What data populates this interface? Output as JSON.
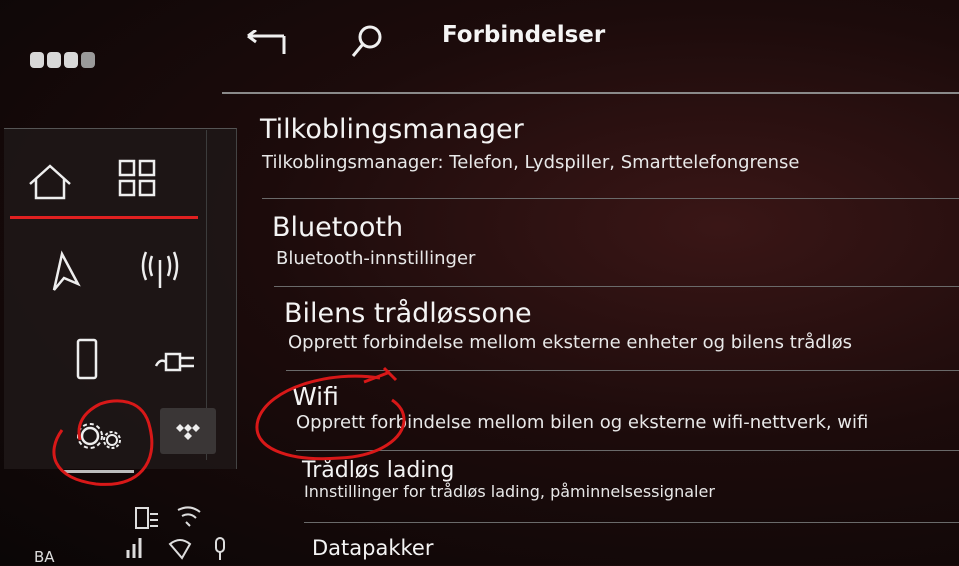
{
  "header": {
    "title": "Forbindelser",
    "back_icon": "back-arrow-icon",
    "search_icon": "search-icon"
  },
  "sidebar": {
    "items": [
      {
        "icon": "home-icon"
      },
      {
        "icon": "apps-grid-icon"
      },
      {
        "icon": "navigation-icon"
      },
      {
        "icon": "radio-antenna-icon"
      },
      {
        "icon": "phone-icon"
      },
      {
        "icon": "charging-plug-icon"
      },
      {
        "icon": "settings-gear-icon",
        "active": true
      },
      {
        "icon": "tidal-icon"
      }
    ],
    "status_label": "BA",
    "accent_color": "#e02020"
  },
  "list": {
    "items": [
      {
        "title": "Tilkoblingsmanager",
        "subtitle": "Tilkoblingsmanager: Telefon, Lydspiller, Smarttelefongrense"
      },
      {
        "title": "Bluetooth",
        "subtitle": "Bluetooth-innstillinger"
      },
      {
        "title": "Bilens trådløssone",
        "subtitle": "Opprett forbindelse mellom eksterne enheter og bilens trådløs"
      },
      {
        "title": "Wifi",
        "subtitle": "Opprett forbindelse mellom bilen og eksterne wifi-nettverk, wifi"
      },
      {
        "title": "Trådløs lading",
        "subtitle": "Innstillinger for trådløs lading, påminnelsessignaler"
      },
      {
        "title": "Datapakker",
        "subtitle": ""
      }
    ]
  },
  "annotation_color": "#d81818"
}
